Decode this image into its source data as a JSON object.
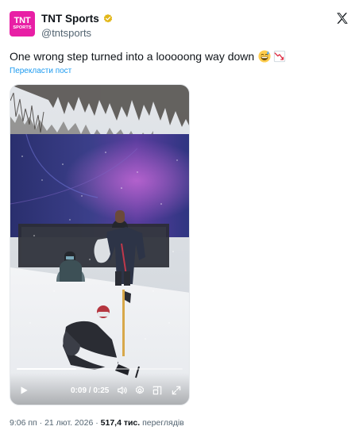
{
  "account": {
    "avatar_line1": "TNT",
    "avatar_line2": "SPORTS",
    "display_name": "TNT Sports",
    "handle": "@tntsports",
    "verified_color": "#e2b719"
  },
  "post": {
    "text": "One wrong step turned into a looooong way down",
    "emojis": [
      "grinning-sweat-emoji",
      "chart-decreasing-emoji"
    ],
    "translate_label": "Перекласти пост"
  },
  "video": {
    "time_display": "0:09 / 0:25",
    "progress_fraction": 0.36,
    "icons": [
      "play-icon",
      "volume-icon",
      "settings-icon",
      "picture-in-picture-icon",
      "fullscreen-icon"
    ]
  },
  "footer": {
    "time": "9:06 пп",
    "separator": "·",
    "date": "21 лют. 2026",
    "views_count": "517,4 тис.",
    "views_label": "переглядів"
  },
  "colors": {
    "accent": "#1d9bf0",
    "brand_pink": "#e81fa5",
    "text_primary": "#0f1419",
    "text_secondary": "#536471"
  }
}
